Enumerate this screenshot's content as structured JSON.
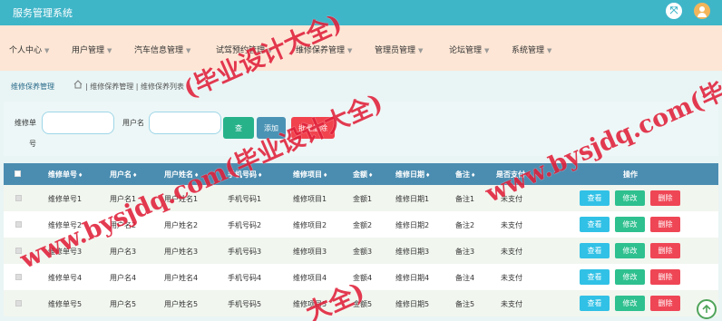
{
  "app": {
    "title": "服务管理系统"
  },
  "topbar": {
    "fullscreen_icon": "expand-icon",
    "avatar_icon": "user-avatar-icon"
  },
  "nav": [
    {
      "label": "个人中心"
    },
    {
      "label": "用户管理"
    },
    {
      "label": "汽车信息管理"
    },
    {
      "label": "试驾预约管理"
    },
    {
      "label": "维修保养管理"
    },
    {
      "label": "管理员管理"
    },
    {
      "label": "论坛管理"
    },
    {
      "label": "系统管理"
    }
  ],
  "breadcrumb": {
    "title": "维修保养管理",
    "home_icon": "home-icon",
    "trail": "| 维修保养管理 | 维修保养列表"
  },
  "search": {
    "field1_label_a": "维修单",
    "field1_label_b": "号",
    "field1_placeholder": "",
    "field2_label": "用户名",
    "field2_placeholder": "",
    "search_label": "查",
    "add_label": "添加",
    "batch_delete_label": "批量删除"
  },
  "table": {
    "columns": [
      "维修单号",
      "用户名",
      "用户姓名",
      "手机号码",
      "维修项目",
      "金额",
      "维修日期",
      "备注",
      "是否支付",
      "操作"
    ],
    "sort_glyph": "♦",
    "rows": [
      {
        "c": [
          "维修单号1",
          "用户名1",
          "用户姓名1",
          "手机号码1",
          "维修项目1",
          "金额1",
          "维修日期1",
          "备注1",
          "未支付"
        ]
      },
      {
        "c": [
          "维修单号2",
          "用户名2",
          "用户姓名2",
          "手机号码2",
          "维修项目2",
          "金额2",
          "维修日期2",
          "备注2",
          "未支付"
        ]
      },
      {
        "c": [
          "维修单号3",
          "用户名3",
          "用户姓名3",
          "手机号码3",
          "维修项目3",
          "金额3",
          "维修日期3",
          "备注3",
          "未支付"
        ]
      },
      {
        "c": [
          "维修单号4",
          "用户名4",
          "用户姓名4",
          "手机号码4",
          "维修项目4",
          "金额4",
          "维修日期4",
          "备注4",
          "未支付"
        ]
      },
      {
        "c": [
          "维修单号5",
          "用户名5",
          "用户姓名5",
          "手机号码5",
          "维修项目5",
          "金额5",
          "维修日期5",
          "备注5",
          "未支付"
        ]
      }
    ],
    "actions": {
      "view": "查看",
      "edit": "修改",
      "delete": "删除"
    }
  },
  "back_to_top_icon": "arrow-up-icon",
  "watermark": {
    "text1": "(毕业设计大全)",
    "text2": "www.bysjdq.com(毕业设计大全)",
    "text3": "www.bysjdq.com(毕业设计大",
    "text4": "大全)"
  },
  "colors": {
    "topbar": "#3fb5c8",
    "navbar": "#fde6d5",
    "table_header": "#4b8db1",
    "view_button": "#31c1e6",
    "edit_button": "#2ec08f",
    "delete_button": "#ef4655",
    "watermark": "#e0203a"
  }
}
